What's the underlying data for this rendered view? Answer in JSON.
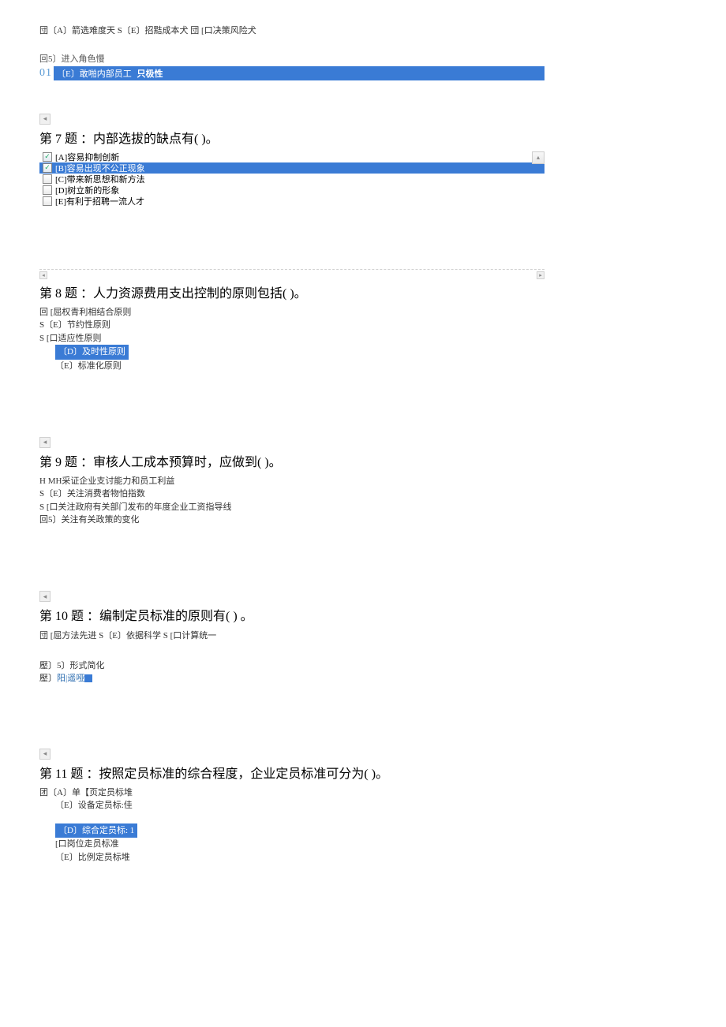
{
  "q6": {
    "line1": "団〔A〕箭选难度天 S〔E〕招黠成本犬 団 [口决策风险犬",
    "line2": "回5〕进入角色慢",
    "prefix": "01",
    "highlight_a": "〔E〕敢啪内部员工",
    "highlight_b": "只极性"
  },
  "q7": {
    "title": "第 7 题 ：内部选拔的缺点有( )。",
    "options": [
      {
        "label": "[A]容易抑制创新",
        "checked": true,
        "highlighted": false
      },
      {
        "label": "[B]容易出现不公正现象",
        "checked": true,
        "highlighted": true
      },
      {
        "label": "[C]带来新思想和新方法",
        "checked": false,
        "highlighted": false
      },
      {
        "label": "[D]树立新的形象",
        "checked": false,
        "highlighted": false
      },
      {
        "label": "[E]有利于招聘一流人才",
        "checked": false,
        "highlighted": false
      }
    ]
  },
  "q8": {
    "title": "第 8 题 ：人力资源费用支出控制的原则包括(  )。",
    "opt_a": "回 [屈权青利相结合原则",
    "opt_b": "S〔E〕节约性原则",
    "opt_c": "S [口适应性原则",
    "opt_d": "〔D〕及时性原则",
    "opt_e": "〔E〕标准化原则"
  },
  "q9": {
    "title": "第 9 题 ：审核人工成本预算时，应做到( )。",
    "opt_a": "H MH采证企业支讨能力和员工利益",
    "opt_b": "S〔E〕关注消费者物怕指数",
    "opt_c": "S [口关注政府有关部门发布的年度企业工资指导线",
    "opt_d": "回5〕关注有关政策的变化"
  },
  "q10": {
    "title": "第 10 题 ：编制定员标准的原则有( ) 。",
    "line1": "団 [屈方法先进 S〔E〕依据科学 S [口计算统一",
    "line2a": "壓〕5〕形式简化",
    "line2b_prefix": "壓〕",
    "line2b_mid": "阳|遥哑"
  },
  "q11": {
    "title": "第 11 题 ：按照定员标准的综合程度，企业定员标准可分为(  )。",
    "opt_a": "团〔A〕单【页定员标堆",
    "opt_b": "〔E〕设备定员标:佳",
    "opt_d": "〔D〕综合定员标: 1",
    "opt_c": "[口岗位走员标准",
    "opt_e": "〔E〕比例定员标堆"
  }
}
